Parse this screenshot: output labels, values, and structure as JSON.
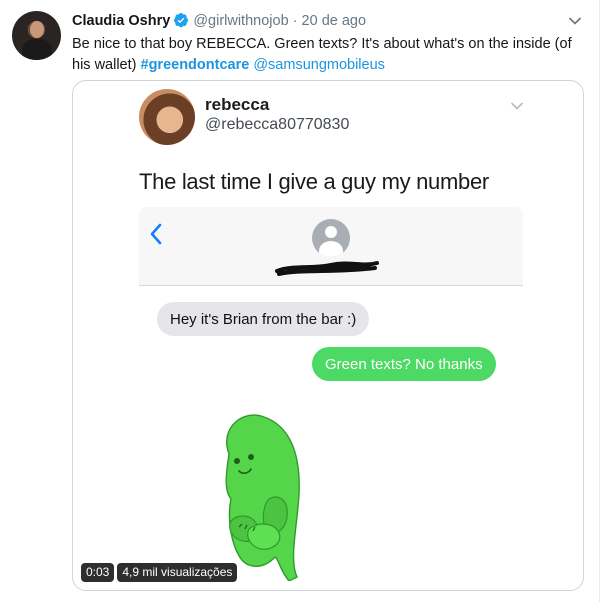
{
  "tweet": {
    "display_name": "Claudia Oshry",
    "handle": "@girlwithnojob",
    "separator": "·",
    "time": "20 de ago",
    "text_main": "Be nice to that boy REBECCA. Green texts? It's about what's on the inside (of his wallet) ",
    "hashtag": "#greendontcare",
    "mention": "@samsungmobileus"
  },
  "media": {
    "embedded_tweet": {
      "name": "rebecca",
      "handle": "@rebecca80770830",
      "text": "The last time I give a guy my number"
    },
    "messages": {
      "incoming": "Hey it's Brian from the bar :)",
      "outgoing": "Green texts? No thanks"
    },
    "video": {
      "duration": "0:03",
      "views": "4,9 mil visualizações"
    }
  },
  "colors": {
    "link": "#1b95e0",
    "verified": "#1da1f2",
    "imessage_back": "#147efb",
    "sms_green": "#4cd964",
    "pickle_green": "#55d64a"
  },
  "icons": [
    "verified-badge-icon",
    "chevron-down-icon",
    "back-arrow-icon",
    "contact-avatar-icon"
  ]
}
